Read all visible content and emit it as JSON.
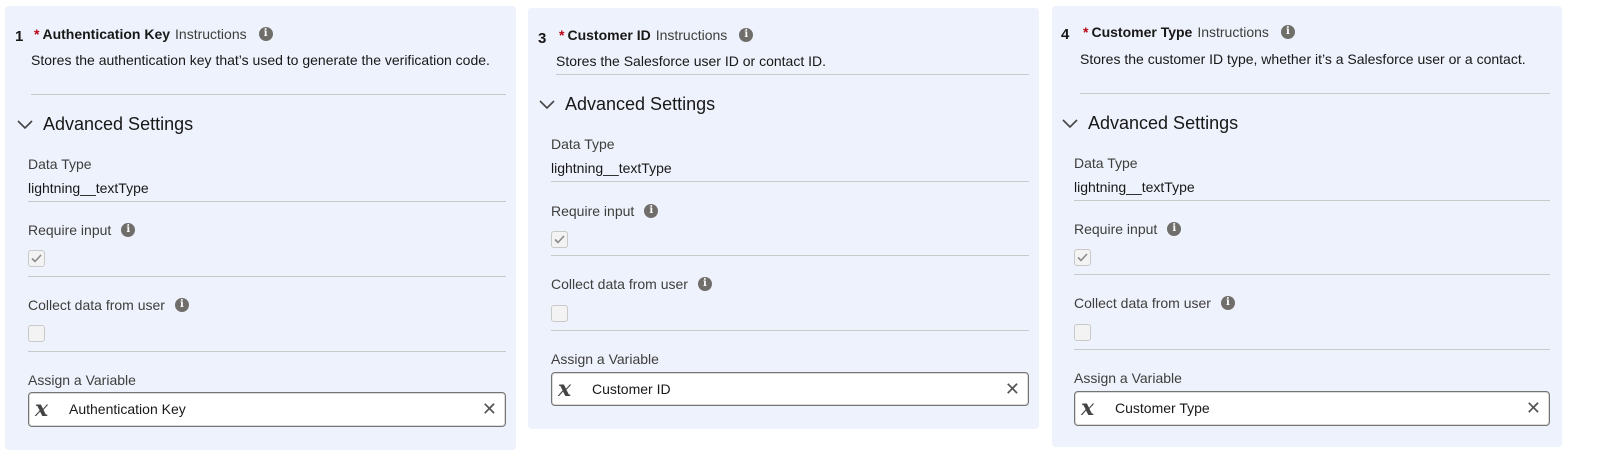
{
  "panels": [
    {
      "number": "1",
      "required": "*",
      "name": "Authentication Key",
      "instructions": "Instructions",
      "description": "Stores the authentication key that’s used to generate the verification code.",
      "advanced": "Advanced Settings",
      "data_type_label": "Data Type",
      "data_type_value": "lightning__textType",
      "require_input_label": "Require input",
      "require_input_checked": true,
      "collect_label": "Collect data from user",
      "collect_checked": false,
      "assign_label": "Assign a Variable",
      "variable": "Authentication Key"
    },
    {
      "number": "3",
      "required": "*",
      "name": "Customer ID",
      "instructions": "Instructions",
      "description": "Stores the Salesforce user ID or contact ID.",
      "advanced": "Advanced Settings",
      "data_type_label": "Data Type",
      "data_type_value": "lightning__textType",
      "require_input_label": "Require input",
      "require_input_checked": true,
      "collect_label": "Collect data from user",
      "collect_checked": false,
      "assign_label": "Assign a Variable",
      "variable": "Customer ID"
    },
    {
      "number": "4",
      "required": "*",
      "name": "Customer Type",
      "instructions": "Instructions",
      "description": "Stores the customer ID type, whether it’s a Salesforce user or a contact.",
      "advanced": "Advanced Settings",
      "data_type_label": "Data Type",
      "data_type_value": "lightning__textType",
      "require_input_label": "Require input",
      "require_input_checked": true,
      "collect_label": "Collect data from user",
      "collect_checked": false,
      "assign_label": "Assign a Variable",
      "variable": "Customer Type"
    }
  ],
  "icons": {
    "info": "i",
    "variable": "x",
    "clear": "✕"
  },
  "colors": {
    "panel_bg": "#eef2fc",
    "required": "#ba0517"
  }
}
